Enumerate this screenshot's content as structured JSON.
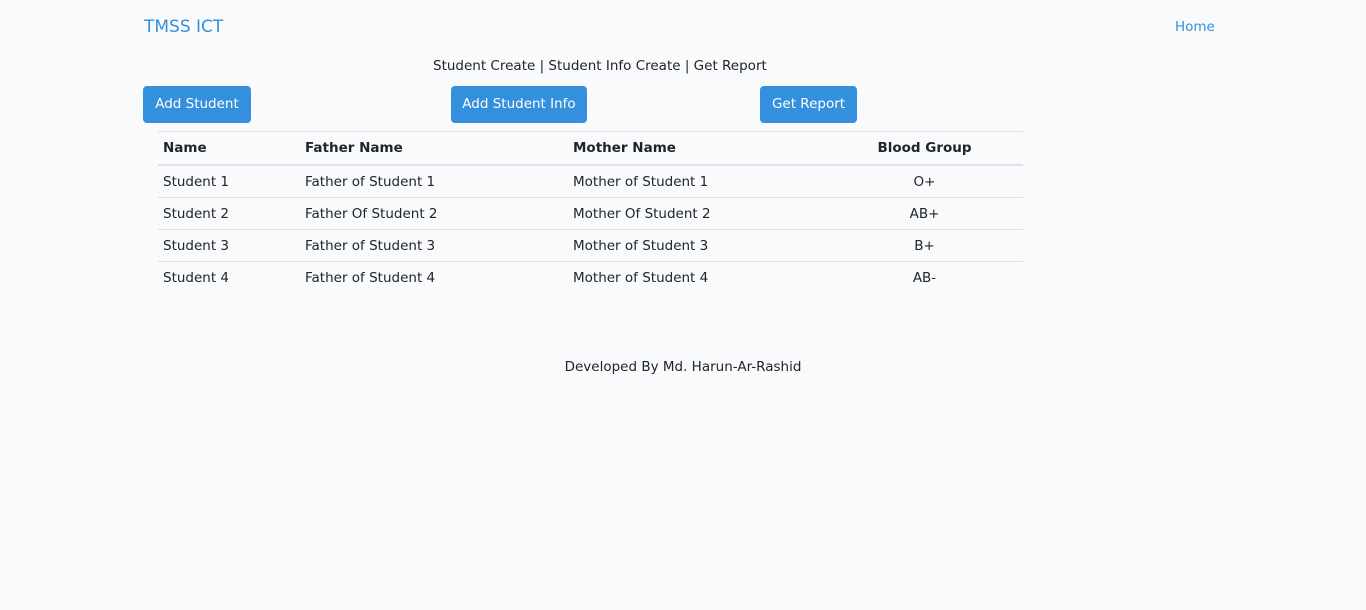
{
  "navbar": {
    "brand": "TMSS ICT",
    "home_link": "Home"
  },
  "breadcrumb": "Student Create | Student Info Create | Get Report",
  "buttons": {
    "add_student": "Add Student",
    "add_student_info": "Add Student Info",
    "get_report": "Get Report"
  },
  "table": {
    "headers": [
      "Name",
      "Father Name",
      "Mother Name",
      "Blood Group"
    ],
    "rows": [
      [
        "Student 1",
        "Father of Student 1",
        "Mother of Student 1",
        "O+"
      ],
      [
        "Student 2",
        "Father Of Student 2",
        "Mother Of Student 2",
        "AB+"
      ],
      [
        "Student 3",
        "Father of Student 3",
        "Mother of Student 3",
        "B+"
      ],
      [
        "Student 4",
        "Father of Student 4",
        "Mother of Student 4",
        "AB-"
      ]
    ]
  },
  "footer": "Developed By Md. Harun-Ar-Rashid",
  "colors": {
    "primary": "#3490dc",
    "background": "#f8fafc",
    "text": "#212529",
    "border": "#dee2e6"
  }
}
